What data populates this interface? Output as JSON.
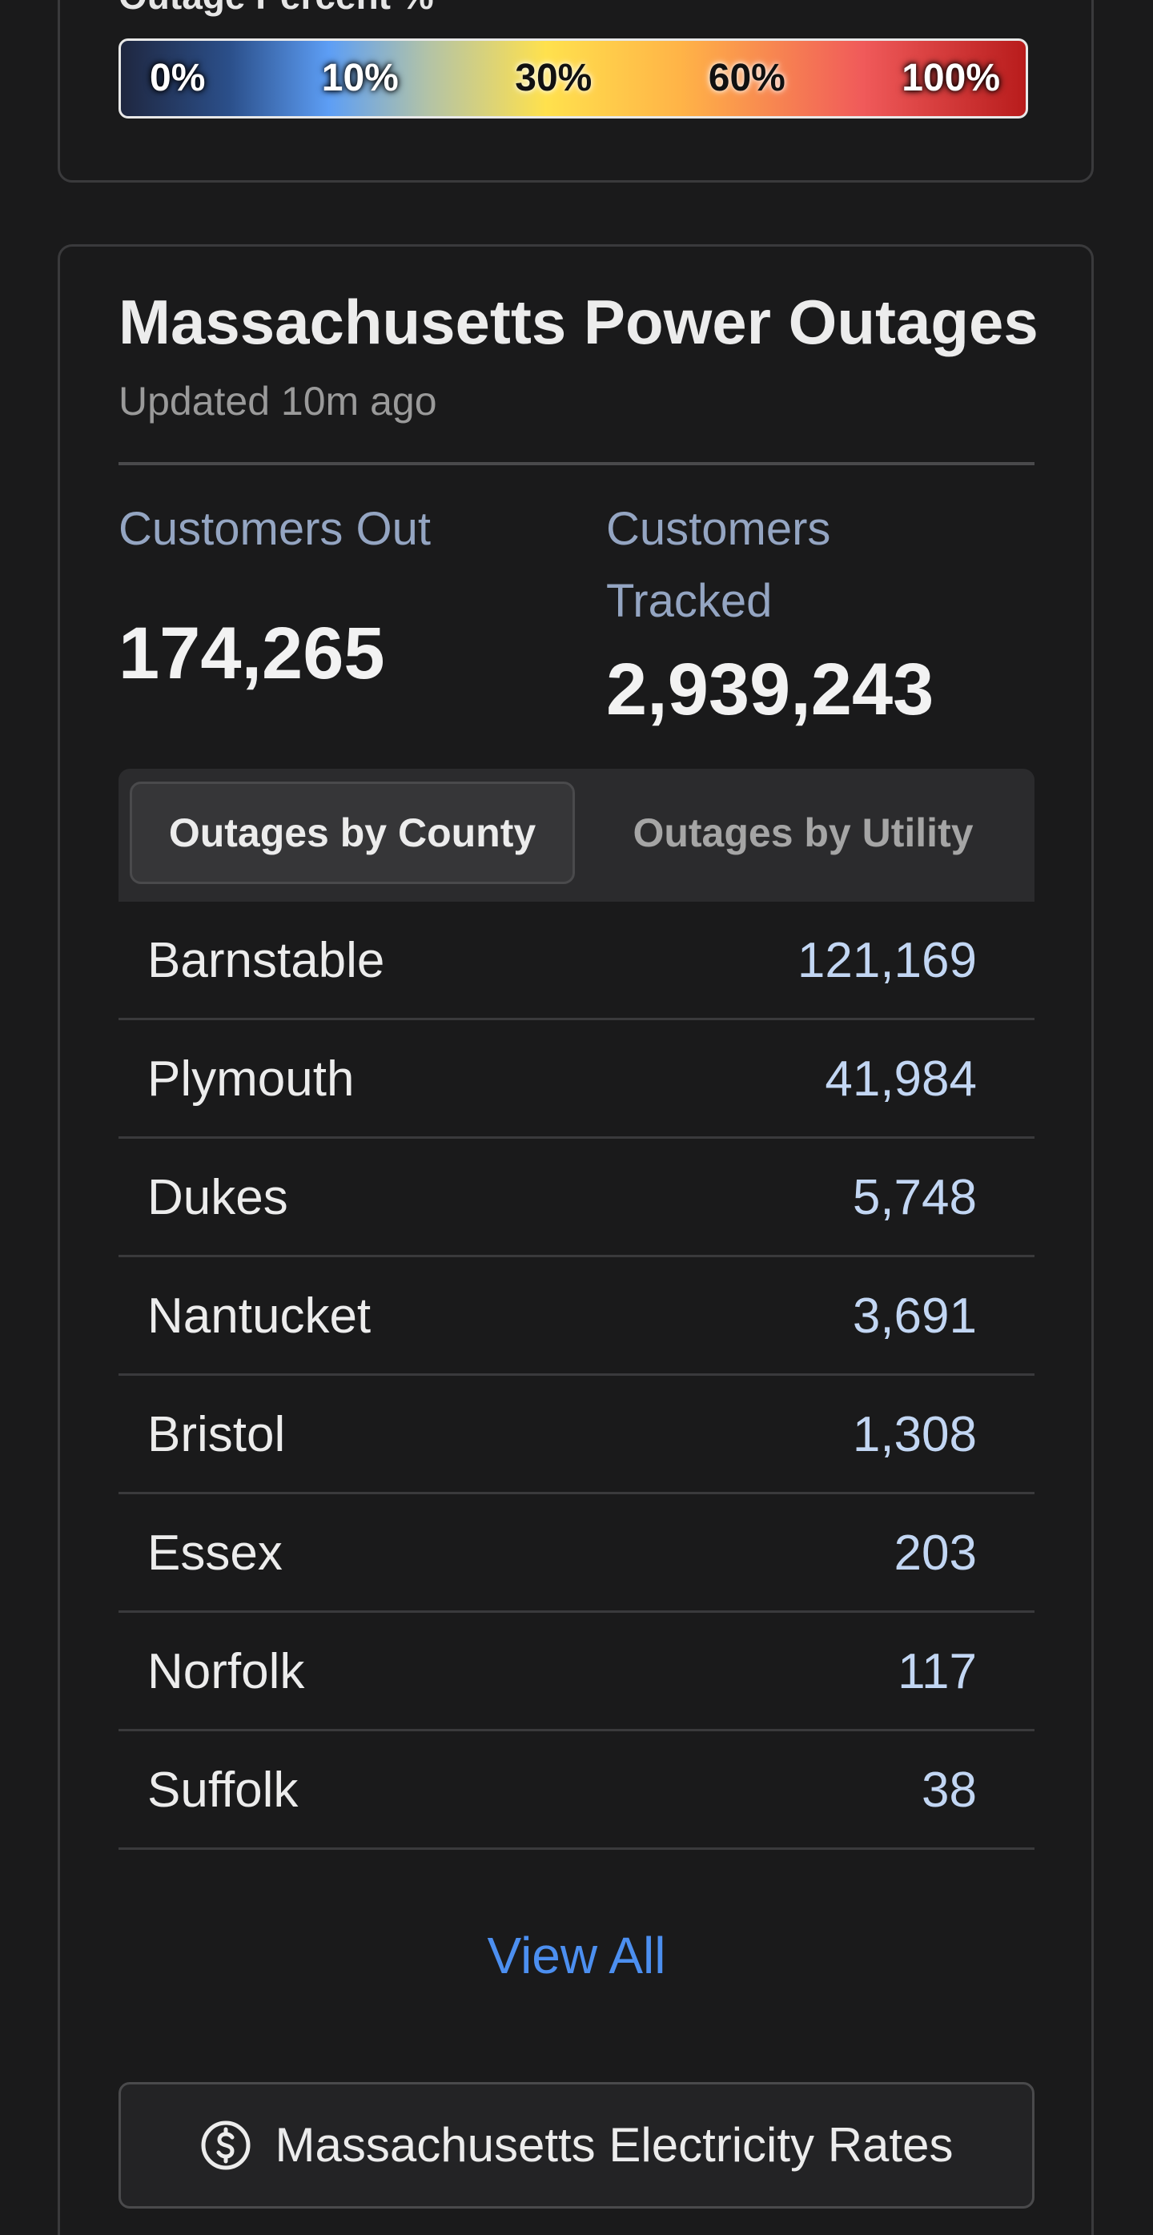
{
  "legend": {
    "title": "Outage Percent %",
    "labels": [
      "0%",
      "10%",
      "30%",
      "60%",
      "100%"
    ]
  },
  "card": {
    "title": "Massachusetts Power Outages",
    "updated": "Updated 10m ago",
    "customers_out_label": "Customers Out",
    "customers_out_value": "174,265",
    "customers_tracked_label": "Customers Tracked",
    "customers_tracked_value": "2,939,243"
  },
  "tabs": {
    "county": "Outages by County",
    "utility": "Outages by Utility"
  },
  "counties": [
    {
      "name": "Barnstable",
      "value": "121,169"
    },
    {
      "name": "Plymouth",
      "value": "41,984"
    },
    {
      "name": "Dukes",
      "value": "5,748"
    },
    {
      "name": "Nantucket",
      "value": "3,691"
    },
    {
      "name": "Bristol",
      "value": "1,308"
    },
    {
      "name": "Essex",
      "value": "203"
    },
    {
      "name": "Norfolk",
      "value": "117"
    },
    {
      "name": "Suffolk",
      "value": "38"
    }
  ],
  "view_all": "View All",
  "rates_button": {
    "label": "Massachusetts Electricity Rates",
    "icon": "dollar-circle-icon"
  },
  "colors": {
    "background": "#1a1a1b",
    "accent_link": "#4c8ff0",
    "stat_label": "#94a5c2",
    "value_blue": "#c2d6f3"
  }
}
